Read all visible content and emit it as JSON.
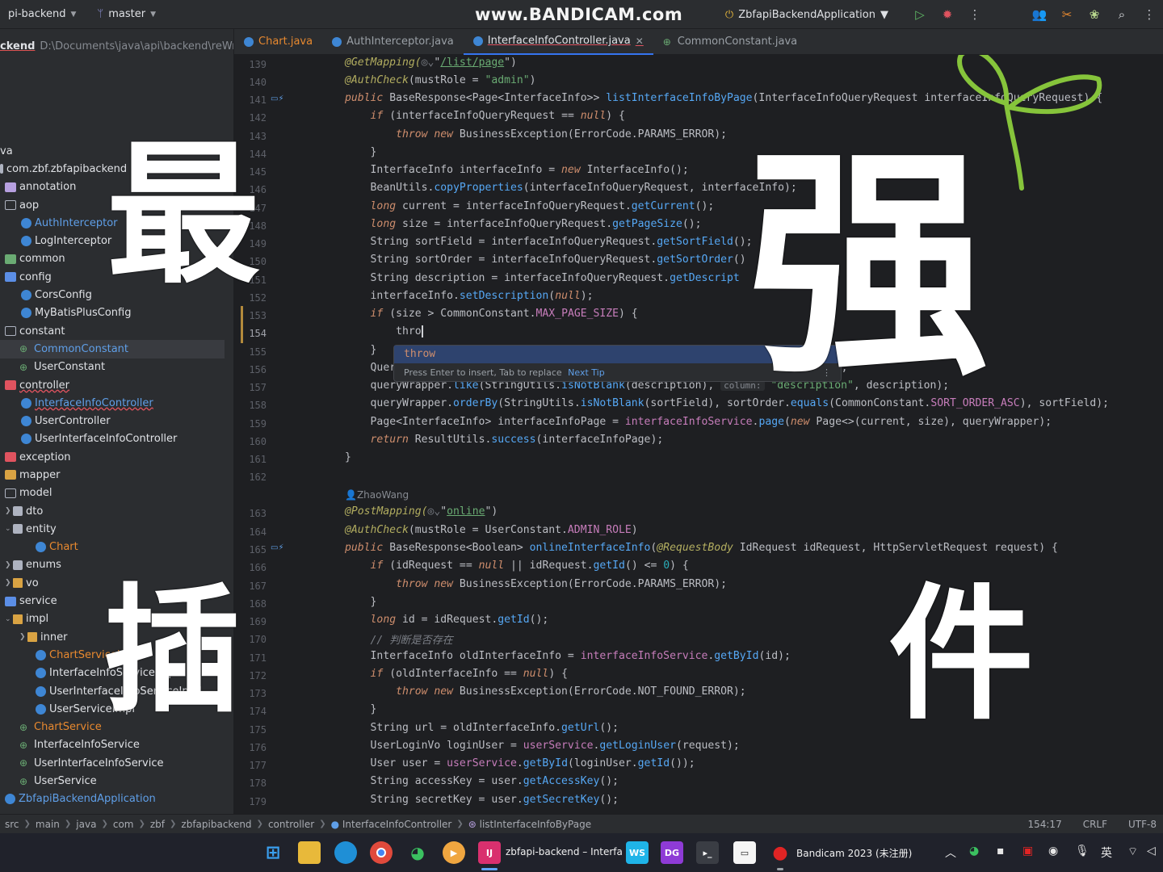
{
  "titlebar": {
    "project": "pi-backend",
    "branch": "master",
    "watermark": "www.BANDICAM.com",
    "run_config": "ZbfapiBackendApplication"
  },
  "sidebar": {
    "project_name": "ckend",
    "project_path": "D:\\Documents\\java\\api\\backend\\reWrit",
    "items": [
      {
        "label": "va",
        "indent": 0
      },
      {
        "label": "com.zbf.zbfapibackend",
        "indent": 0
      },
      {
        "label": "annotation",
        "indent": 0
      },
      {
        "label": "aop",
        "indent": 0
      },
      {
        "label": "AuthInterceptor",
        "indent": 1
      },
      {
        "label": "LogInterceptor",
        "indent": 1
      },
      {
        "label": "common",
        "indent": 0
      },
      {
        "label": "config",
        "indent": 0
      },
      {
        "label": "CorsConfig",
        "indent": 1
      },
      {
        "label": "MyBatisPlusConfig",
        "indent": 1
      },
      {
        "label": "constant",
        "indent": 0
      },
      {
        "label": "CommonConstant",
        "indent": 1
      },
      {
        "label": "UserConstant",
        "indent": 1
      },
      {
        "label": "controller",
        "indent": 0
      },
      {
        "label": "InterfaceInfoController",
        "indent": 1
      },
      {
        "label": "UserController",
        "indent": 1
      },
      {
        "label": "UserInterfaceInfoController",
        "indent": 1
      },
      {
        "label": "exception",
        "indent": 0
      },
      {
        "label": "mapper",
        "indent": 0
      },
      {
        "label": "model",
        "indent": 0
      },
      {
        "label": "dto",
        "indent": 0
      },
      {
        "label": "entity",
        "indent": 0
      },
      {
        "label": "Chart",
        "indent": 1
      },
      {
        "label": "enums",
        "indent": 0
      },
      {
        "label": "vo",
        "indent": 0
      },
      {
        "label": "service",
        "indent": 0
      },
      {
        "label": "impl",
        "indent": 0
      },
      {
        "label": "inner",
        "indent": 1
      },
      {
        "label": "ChartServiceImpl",
        "indent": 1
      },
      {
        "label": "InterfaceInfoServiceImpl",
        "indent": 1
      },
      {
        "label": "UserInterfaceInfoServiceImpl",
        "indent": 1
      },
      {
        "label": "UserServiceImpl",
        "indent": 1
      },
      {
        "label": "ChartService",
        "indent": 0
      },
      {
        "label": "InterfaceInfoService",
        "indent": 0
      },
      {
        "label": "UserInterfaceInfoService",
        "indent": 0
      },
      {
        "label": "UserService",
        "indent": 0
      },
      {
        "label": "ZbfapiBackendApplication",
        "indent": 0
      }
    ]
  },
  "tabs": [
    {
      "label": "Chart.java",
      "active": false
    },
    {
      "label": "AuthInterceptor.java",
      "active": false
    },
    {
      "label": "InterfaceInfoController.java",
      "active": true
    },
    {
      "label": "CommonConstant.java",
      "active": false
    }
  ],
  "editor": {
    "lines": [
      "139",
      "140",
      "141",
      "142",
      "143",
      "144",
      "145",
      "146",
      "147",
      "148",
      "149",
      "150",
      "151",
      "152",
      "153",
      "154",
      "155",
      "156",
      "157",
      "158",
      "159",
      "160",
      "161",
      "162",
      "163",
      "164",
      "165",
      "166",
      "167",
      "168",
      "169",
      "170",
      "171",
      "172",
      "173",
      "174",
      "175",
      "176",
      "177",
      "178",
      "179"
    ],
    "current_line": "154",
    "author": "ZhaoWang",
    "code": {
      "l139_ann": "@GetMapping(",
      "l139_url": "/list/page",
      "l140_ann": "@AuthCheck",
      "l140_rest": "(mustRole = ",
      "l140_str": "\"admin\"",
      "l141_kw": "public",
      "l141_type": " BaseResponse<Page<InterfaceInfo>> ",
      "l141_fn": "listInterfaceInfoByPage",
      "l141_rest": "(InterfaceInfoQueryRequest interfaceInfoQueryRequest) {",
      "l142": "(interfaceInfoQueryRequest == ",
      "l143": "BusinessException(ErrorCode.PARAMS_ERROR);",
      "l145": "InterfaceInfo interfaceInfo = ",
      "l145b": "InterfaceInfo();",
      "l146": "BeanUtils.",
      "l146b": "copyProperties",
      "l146c": "(interfaceInfoQueryRequest, interfaceInfo);",
      "l147": "current = interfaceInfoQueryRequest.",
      "l147b": "getCurrent",
      "l148": "size = interfaceInfoQueryRequest.",
      "l148b": "getPageSize",
      "l149": "String sortField = interfaceInfoQueryRequest.",
      "l149b": "getSortField",
      "l150": "String sortOrder = interfaceInfoQueryRequest.",
      "l150b": "getSortOrder",
      "l151": "String description = interfaceInfoQueryRequest.",
      "l151b": "getDescript",
      "l152": "interfaceInfo.",
      "l152b": "setDescription",
      "l153": "(size > CommonConstant.",
      "l153b": "MAX_PAGE_SIZE",
      "l154": "thro",
      "l156": "Quer",
      "l156b": "nfo);",
      "l157": "queryWrapper.",
      "l157b": "like",
      "l157c": "(StringUtils.",
      "l157d": "isNotBlank",
      "l157e": "(description), ",
      "l157hint": "column:",
      "l157str": "\"description\"",
      "l157f": ", description);",
      "l158": "queryWrapper.",
      "l158b": "orderBy",
      "l158c": "(StringUtils.",
      "l158d": "isNotBlank",
      "l158e": "(sortField), sortOrder.",
      "l158f": "equals",
      "l158g": "(CommonConstant.",
      "l158h": "SORT_ORDER_ASC",
      "l158i": "), sortField);",
      "l159": "Page<InterfaceInfo> interfaceInfoPage = ",
      "l159b": "interfaceInfoService",
      "l159c": "page",
      "l159d": "Page<>(current, size), queryWrapper);",
      "l160": "ResultUtils.",
      "l160b": "success",
      "l160c": "(interfaceInfoPage);",
      "l163_ann": "@PostMapping(",
      "l163_url": "online",
      "l164_ann": "@AuthCheck",
      "l164_rest": "(mustRole = UserConstant.",
      "l164_cst": "ADMIN_ROLE",
      "l165_fn": "onlineInterfaceInfo",
      "l165_type": " BaseResponse<Boolean> ",
      "l165_ann": "@RequestBody",
      "l165_rest": " IdRequest idRequest, HttpServletRequest request) {",
      "l166": "(idRequest == ",
      "l166b": " || idRequest.",
      "l166c": "getId",
      "l166d": "() <= ",
      "l167": "BusinessException(ErrorCode.PARAMS_ERROR);",
      "l169": "id = idRequest.",
      "l169b": "getId",
      "l170": "// 判断是否存在",
      "l171": "InterfaceInfo oldInterfaceInfo = ",
      "l171b": "interfaceInfoService",
      "l171c": "getById",
      "l171d": "(id);",
      "l172": "(oldInterfaceInfo == ",
      "l173": "BusinessException(ErrorCode.NOT_FOUND_ERROR);",
      "l175": "String url = oldInterfaceInfo.",
      "l175b": "getUrl",
      "l176": "UserLoginVo loginUser = ",
      "l176b": "userService",
      "l176c": "getLoginUser",
      "l176d": "(request);",
      "l177": "User user = ",
      "l177b": "userService",
      "l177c": "getById",
      "l177d": "(loginUser.",
      "l177e": "getId",
      "l177f": "());",
      "l178": "String accessKey = user.",
      "l178b": "getAccessKey",
      "l179": "String secretKey = user.",
      "l179b": "getSecretKey"
    },
    "popup": {
      "item": "throw",
      "hint": "Press Enter to insert, Tab to replace",
      "next_tip": "Next Tip"
    }
  },
  "statusbar": {
    "crumbs": [
      "src",
      "main",
      "java",
      "com",
      "zbf",
      "zbfapibackend",
      "controller",
      "InterfaceInfoController",
      "listInterfaceInfoByPage"
    ],
    "position": "154:17",
    "line_sep": "CRLF",
    "encoding": "UTF-8"
  },
  "taskbar": {
    "active_app": "zbfapi-backend – Interfa",
    "bandicam": "Bandicam 2023 (未注册)",
    "ime": "英"
  },
  "overlay": {
    "char1": "最",
    "char2": "强",
    "char3": "插",
    "char4": "件"
  },
  "colors": {
    "accent": "#3574f0",
    "background": "#1e1f22",
    "panel": "#2b2d30",
    "keyword": "#cf8e6d",
    "string": "#6aab73",
    "function": "#56a8f5",
    "annotation": "#b3ae60",
    "constant": "#c77dbb",
    "sprout": "#86c43b"
  }
}
